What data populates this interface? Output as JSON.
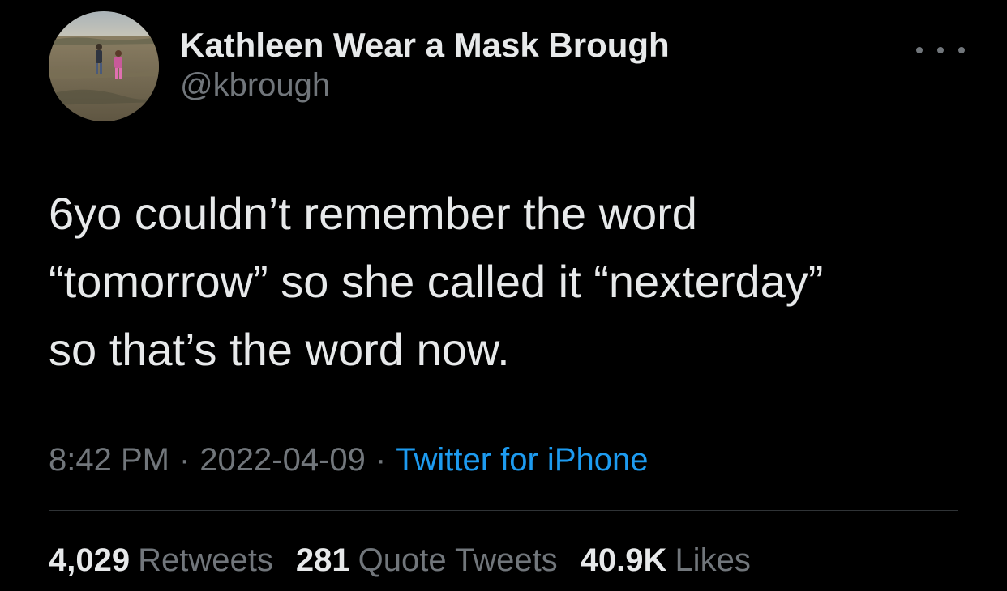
{
  "author": {
    "display_name": "Kathleen Wear a Mask Brough",
    "handle": "@kbrough"
  },
  "tweet": {
    "text": "6yo couldn’t remember the word\n“tomorrow” so she called it “nexterday”\nso that’s the word now."
  },
  "meta": {
    "time": "8:42 PM",
    "date": "2022-04-09",
    "separator": "·",
    "source": "Twitter for iPhone"
  },
  "stats": {
    "retweets": {
      "count": "4,029",
      "label": "Retweets"
    },
    "quotes": {
      "count": "281",
      "label": "Quote Tweets"
    },
    "likes": {
      "count": "40.9K",
      "label": "Likes"
    }
  },
  "icons": {
    "more": "more-horizontal-icon"
  },
  "colors": {
    "background": "#000000",
    "text_primary": "#e7e9ea",
    "text_secondary": "#71767b",
    "link": "#1d9bf0",
    "divider": "#2f3336"
  }
}
